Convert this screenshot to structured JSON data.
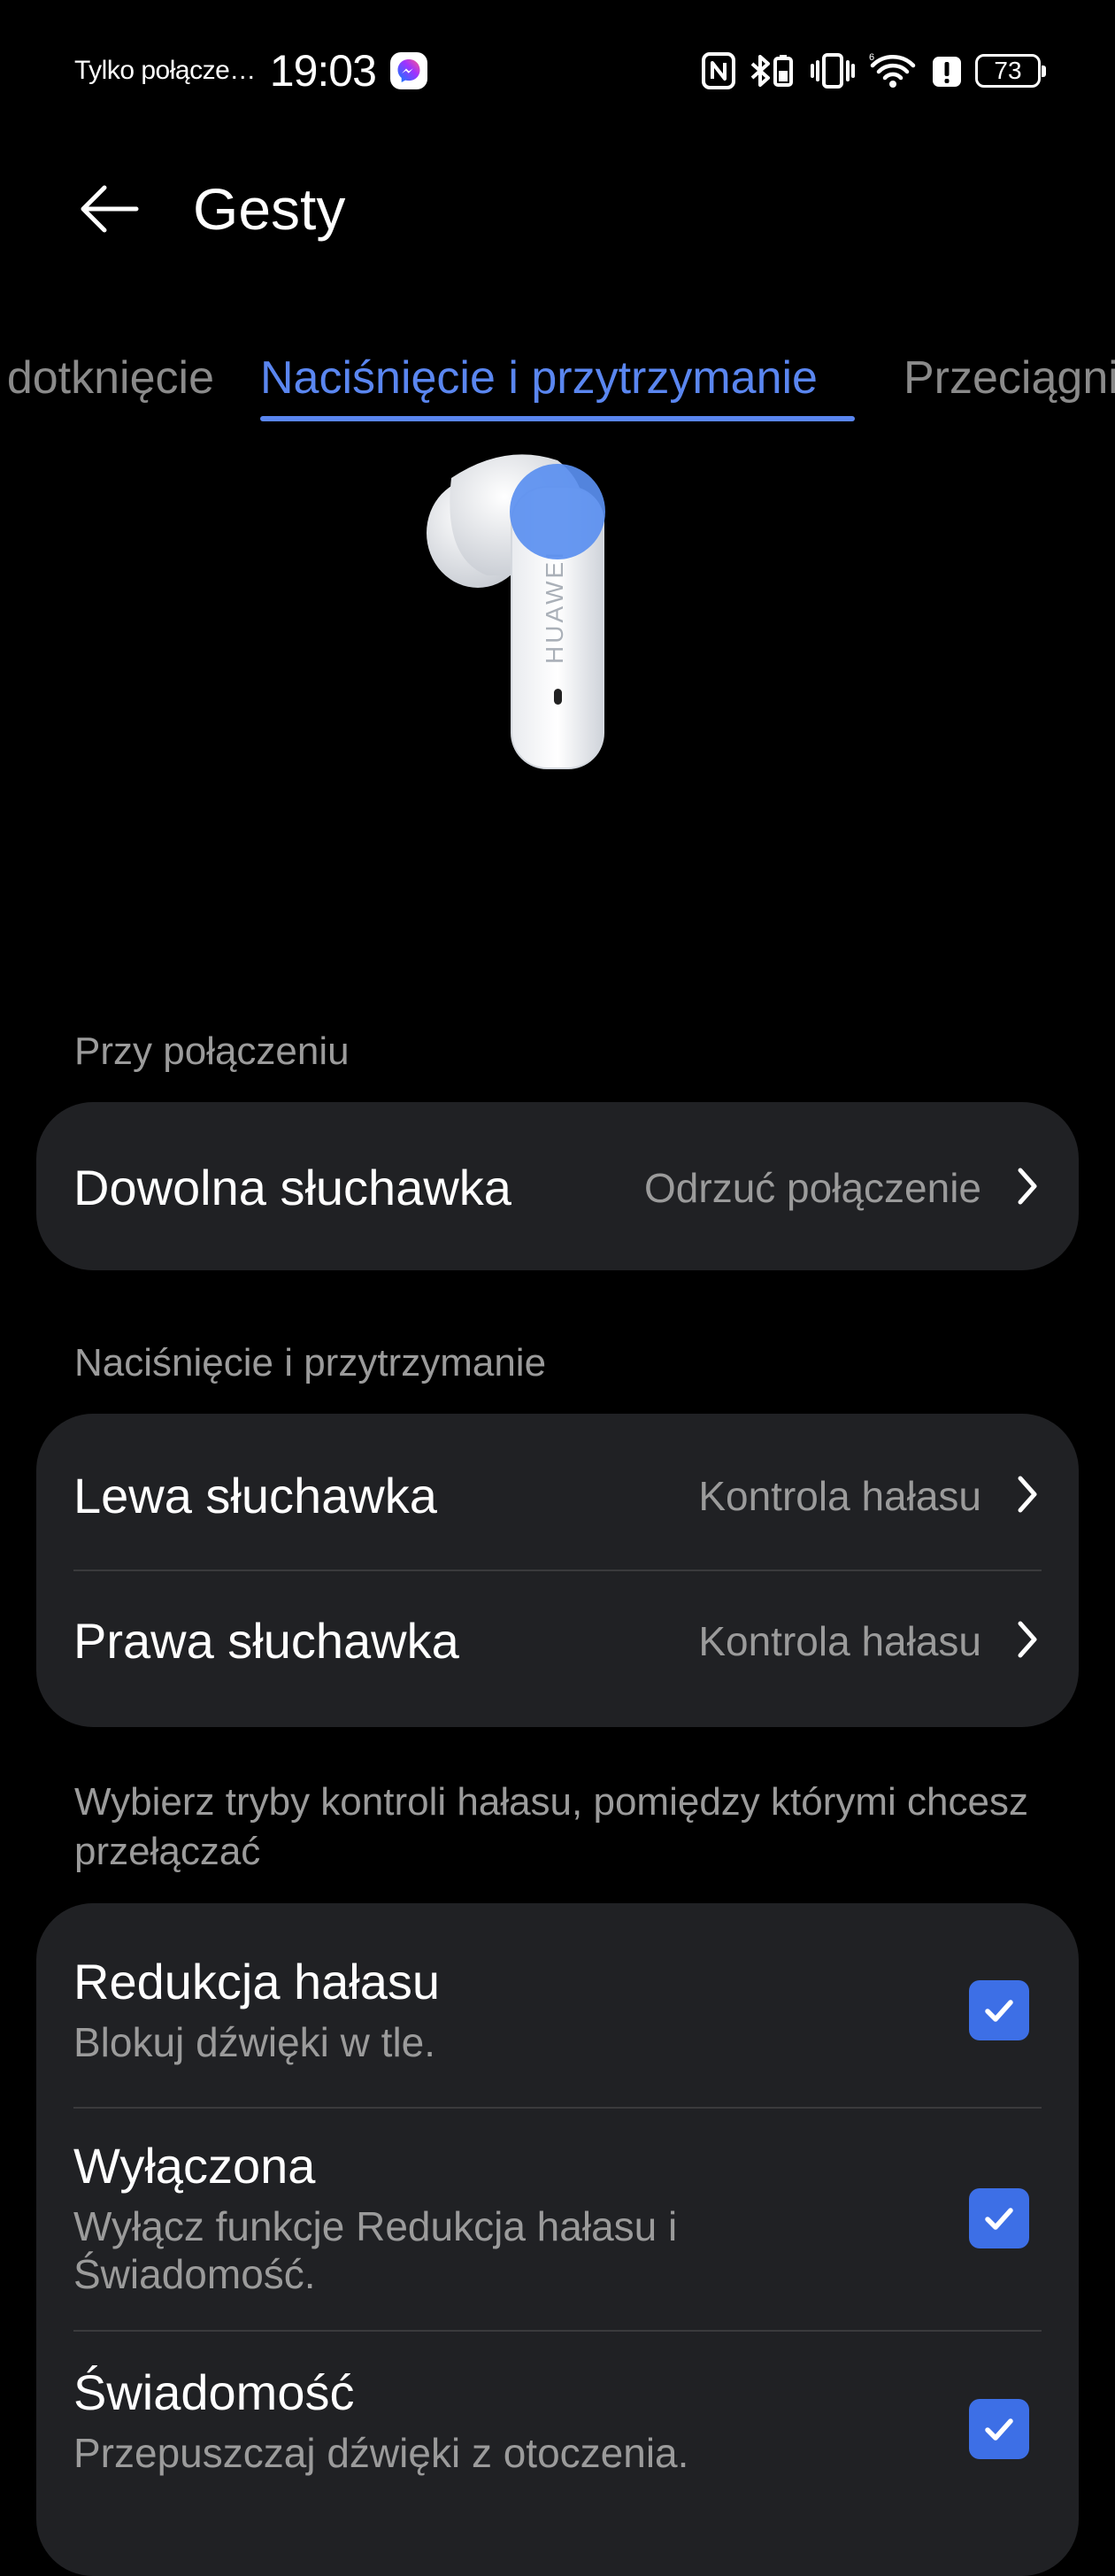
{
  "status_bar": {
    "carrier": "Tylko połącze…",
    "time": "19:03",
    "battery": "73"
  },
  "header": {
    "title": "Gesty"
  },
  "tabs": [
    {
      "label": "dotknięcie",
      "active": false
    },
    {
      "label": "Naciśnięcie i przytrzymanie",
      "active": true
    },
    {
      "label": "Przeciągnij",
      "active": false
    }
  ],
  "earbud": {
    "brand": "HUAWEI"
  },
  "sections": {
    "call": {
      "label": "Przy połączeniu",
      "rows": [
        {
          "title": "Dowolna słuchawka",
          "value": "Odrzuć połączenie"
        }
      ]
    },
    "press_hold": {
      "label": "Naciśnięcie i przytrzymanie",
      "rows": [
        {
          "title": "Lewa słuchawka",
          "value": "Kontrola hałasu"
        },
        {
          "title": "Prawa słuchawka",
          "value": "Kontrola hałasu"
        }
      ]
    },
    "noise": {
      "label": "Wybierz tryby kontroli hałasu, pomiędzy którymi chcesz przełączać",
      "options": [
        {
          "title": "Redukcja hałasu",
          "subtitle": "Blokuj dźwięki w tle.",
          "checked": true
        },
        {
          "title": "Wyłączona",
          "subtitle": "Wyłącz funkcje Redukcja hałasu i Świadomość.",
          "checked": true
        },
        {
          "title": "Świadomość",
          "subtitle": "Przepuszczaj dźwięki z otoczenia.",
          "checked": true
        }
      ]
    }
  },
  "colors": {
    "accent": "#5a86f0",
    "checkbox": "#3d6fe6",
    "card": "#202124",
    "secondary_text": "#9b9b9b"
  }
}
